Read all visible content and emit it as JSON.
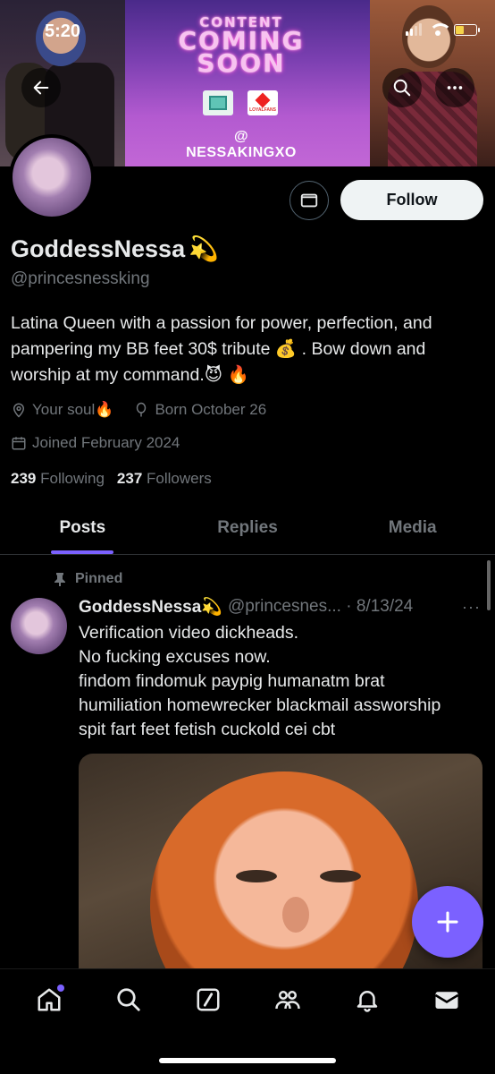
{
  "status_bar": {
    "time": "5:20"
  },
  "banner": {
    "title_lines": [
      "CONTENT",
      "COMING",
      "SOON"
    ],
    "logo_label": "LOYALFANS",
    "handle": "@ NESSAKINGXO"
  },
  "profile": {
    "display_name": "GoddessNessa",
    "name_emoji": "💫",
    "handle": "@princesnessking",
    "bio": "Latina Queen with a passion for power, perfection, and pampering my BB feet 30$ tribute 💰 . Bow down and worship at my command.😈 🔥",
    "location": "Your soul🔥",
    "birthday": "Born October 26",
    "joined": "Joined February 2024",
    "following_count": "239",
    "following_label": "Following",
    "followers_count": "237",
    "followers_label": "Followers",
    "follow_label": "Follow"
  },
  "tabs": [
    {
      "label": "Posts",
      "active": true
    },
    {
      "label": "Replies",
      "active": false
    },
    {
      "label": "Media",
      "active": false
    }
  ],
  "post": {
    "pinned_label": "Pinned",
    "author": "GoddessNessa💫",
    "handle_date": "@princesnes... · 8/13/24",
    "more": "···",
    "text_lines": [
      "Verification video dickheads.",
      "No fucking excuses now.",
      "findom findomuk paypig humanatm brat",
      "humiliation homewrecker blackmail assworship",
      "spit fart feet fetish cuckold cei cbt"
    ]
  },
  "colors": {
    "accent": "#7b61ff",
    "muted": "#71767b",
    "text": "#e7e9ea"
  },
  "icons": {
    "nav": [
      "home-icon",
      "search-icon",
      "grok-icon",
      "communities-icon",
      "notifications-icon",
      "messages-icon"
    ]
  }
}
